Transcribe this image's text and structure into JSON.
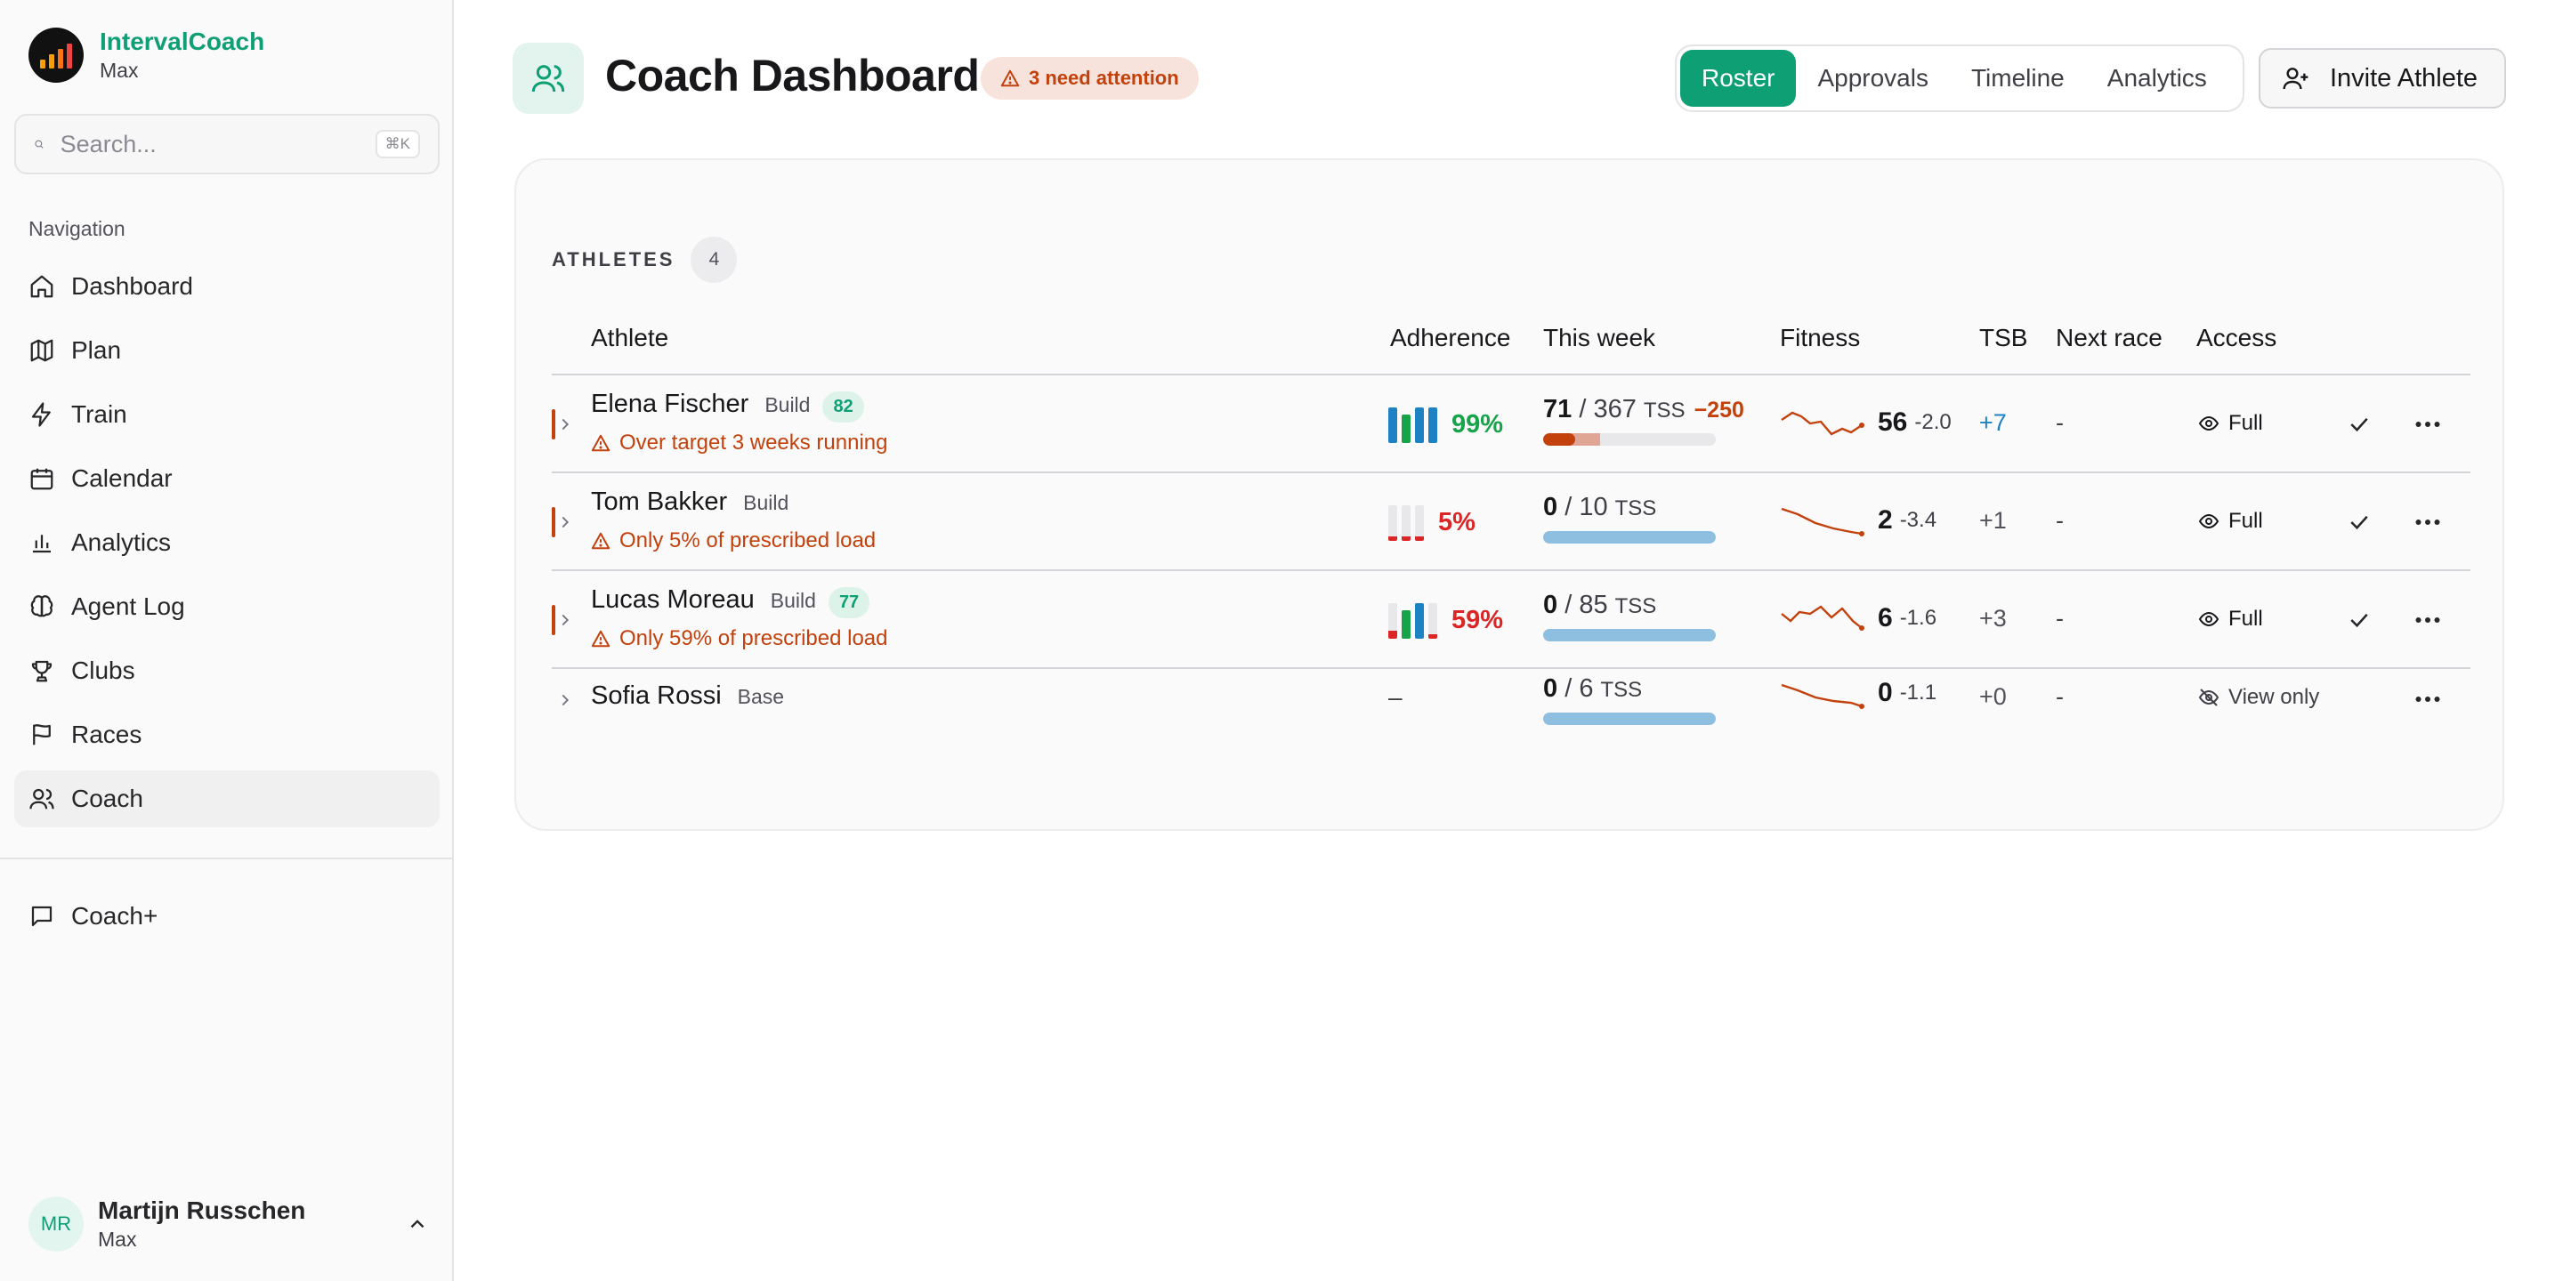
{
  "brand": {
    "name": "IntervalCoach",
    "sub": "Max"
  },
  "search": {
    "placeholder": "Search...",
    "shortcut": "⌘K"
  },
  "nav": {
    "title": "Navigation",
    "items": [
      {
        "label": "Dashboard",
        "icon": "home-icon"
      },
      {
        "label": "Plan",
        "icon": "map-icon"
      },
      {
        "label": "Train",
        "icon": "lightning-icon"
      },
      {
        "label": "Calendar",
        "icon": "calendar-icon"
      },
      {
        "label": "Analytics",
        "icon": "bar-chart-icon"
      },
      {
        "label": "Agent Log",
        "icon": "brain-icon"
      },
      {
        "label": "Clubs",
        "icon": "trophy-icon"
      },
      {
        "label": "Races",
        "icon": "flag-icon"
      },
      {
        "label": "Coach",
        "icon": "users-icon",
        "active": true
      }
    ],
    "extra": {
      "label": "Coach+",
      "icon": "message-icon"
    }
  },
  "user": {
    "initials": "MR",
    "name": "Martijn Russchen",
    "sub": "Max"
  },
  "header": {
    "title": "Coach Dashboard",
    "attention": "3 need attention",
    "tabs": [
      "Roster",
      "Approvals",
      "Timeline",
      "Analytics"
    ],
    "active_tab": "Roster",
    "invite_label": "Invite Athlete"
  },
  "roster": {
    "label": "ATHLETES",
    "count": "4",
    "columns": {
      "athlete": "Athlete",
      "adherence": "Adherence",
      "week": "This week",
      "fitness": "Fitness",
      "tsb": "TSB",
      "race": "Next race",
      "access": "Access"
    },
    "rows": [
      {
        "name": "Elena Fischer",
        "phase": "Build",
        "score": "82",
        "warning": "Over target 3 weeks running",
        "adherence": "99%",
        "adherence_status": "good",
        "week_done": "71",
        "week_target": "/ 367",
        "tss": "TSS",
        "week_delta": "−250",
        "fitness": "56",
        "fitness_delta": "-2.0",
        "tsb": "+7",
        "race": "-",
        "access": "Full",
        "approved": true
      },
      {
        "name": "Tom Bakker",
        "phase": "Build",
        "score": "",
        "warning": "Only 5% of prescribed load",
        "adherence": "5%",
        "adherence_status": "bad",
        "week_done": "0",
        "week_target": "/ 10",
        "tss": "TSS",
        "week_delta": "",
        "fitness": "2",
        "fitness_delta": "-3.4",
        "tsb": "+1",
        "race": "-",
        "access": "Full",
        "approved": true
      },
      {
        "name": "Lucas Moreau",
        "phase": "Build",
        "score": "77",
        "warning": "Only 59% of prescribed load",
        "adherence": "59%",
        "adherence_status": "bad",
        "week_done": "0",
        "week_target": "/ 85",
        "tss": "TSS",
        "week_delta": "",
        "fitness": "6",
        "fitness_delta": "-1.6",
        "tsb": "+3",
        "race": "-",
        "access": "Full",
        "approved": true
      },
      {
        "name": "Sofia Rossi",
        "phase": "Base",
        "score": "",
        "warning": "",
        "adherence": "–",
        "adherence_status": "none",
        "week_done": "0",
        "week_target": "/ 6",
        "tss": "TSS",
        "week_delta": "",
        "fitness": "0",
        "fitness_delta": "-1.1",
        "tsb": "+0",
        "race": "-",
        "access": "View only",
        "approved": false
      }
    ]
  },
  "colors": {
    "accent": "#0f9f74",
    "warning": "#c2410c",
    "good": "#16a34a",
    "bad": "#dc2626",
    "blue": "#1d82c4"
  }
}
